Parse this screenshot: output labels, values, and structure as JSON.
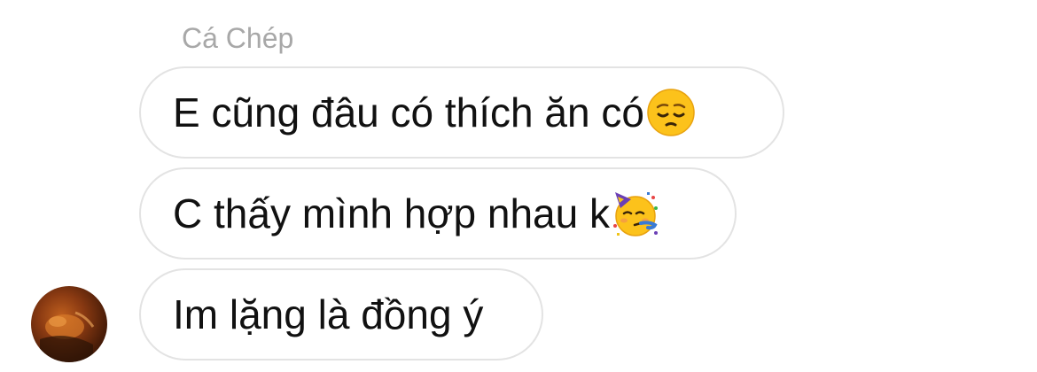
{
  "conversation": {
    "sender_name": "Cá Chép",
    "messages": [
      {
        "text": "E cũng đâu có thích ăn có",
        "emoji": "pensive-face"
      },
      {
        "text": "C thấy mình hợp nhau k",
        "emoji": "partying-face"
      },
      {
        "text": "Im lặng là đồng ý",
        "emoji": ""
      }
    ]
  },
  "colors": {
    "bubble_border": "#e3e3e3",
    "sender_name": "#a8a8a8",
    "message_text": "#111111"
  }
}
